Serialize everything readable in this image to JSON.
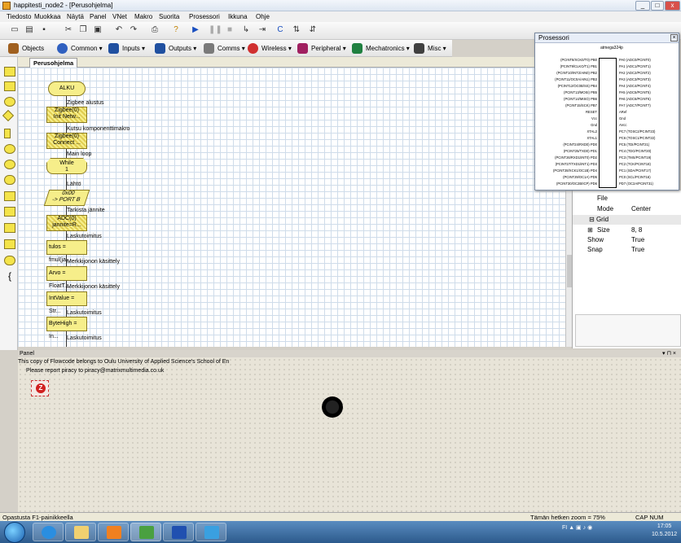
{
  "window": {
    "title": "happitesti_node2 - [Perusohjelma]",
    "buttons": [
      "_",
      "□",
      "x"
    ]
  },
  "menu": [
    "Tiedosto",
    "Muokkaa",
    "Näytä",
    "Panel",
    "VNet",
    "Makro",
    "Suorita",
    "Prosessori",
    "Ikkuna",
    "Ohje"
  ],
  "toolbar2": [
    "Objects",
    "Common",
    "Inputs",
    "Outputs",
    "Comms",
    "Wireless",
    "Peripheral",
    "Mechatronics",
    "Misc"
  ],
  "tab": "Perusohjelma",
  "flowchart": {
    "blocks": [
      "ALKU",
      "Zigbee(0)\nInit  Netw...",
      "Zigbee(0)\nConnect ...",
      "While\n1",
      "0x00\n-> PORT B",
      "ADC(0)\njannite=R...",
      "tulos = fmul(ja...",
      "Arvo = FloatT...",
      "IntValue = Str...",
      "ByteHigh = In..."
    ],
    "comments": [
      "Zigbee alustus",
      "Kutsu komponenttimakro",
      "Main loop",
      "Lähtö",
      "Tarkista jännite",
      "Laskutoimitus",
      "Merkkijonon käsittely",
      "Merkkijonon käsittely",
      "Laskutoimitus",
      "Laskutoimitus"
    ]
  },
  "processor": {
    "title": "Prosessori",
    "chip": "atmega324p",
    "left_pins": [
      "(PCINT8/XCK0/T0) PB0",
      "(PCINT9/CLKO/T1) PB1",
      "(PCINT10/INT2/AIN0) PB2",
      "(PCINT11/OC0A/AIN1) PB3",
      "(PCINT12/OC0B/SS) PB4",
      "(PCINT13/MOSI) PB5",
      "(PCINT14/MISO) PB6",
      "(PCINT15/SCK) PB7",
      "RESET",
      "Vcc",
      "Gnd",
      "XTAL2",
      "XTAL1",
      "(PCINT24/RXD0) PD0",
      "(PCINT25/TXD0) PD1",
      "(PCINT26/RXD1/INT0) PD2",
      "(PCINT27/TXD1/INT1) PD3",
      "(PCINT28/XCK1/OC1B) PD4",
      "(PCINT29/OC1A) PD5",
      "(PCINT30/OC2B/ICP) PD6"
    ],
    "right_pins": [
      "PA0 (ADC0/PCINT0)",
      "PA1 (ADC1/PCINT1)",
      "PA2 (ADC2/PCINT2)",
      "PA3 (ADC3/PCINT3)",
      "PA4 (ADC4/PCINT4)",
      "PA5 (ADC5/PCINT5)",
      "PA6 (ADC6/PCINT6)",
      "PA7 (ADC7/PCINT7)",
      "ARef",
      "Gnd",
      "AVcc",
      "PC7 (TOSC2/PCINT23)",
      "PC6 (TOSC1/PCINT22)",
      "PC5 (TDI/PCINT21)",
      "PC4 (TDO/PCINT20)",
      "PC3 (TMS/PCINT19)",
      "PC2 (TCK/PCINT18)",
      "PC1 (SDA/PCINT17)",
      "PC0 (SCL/PCINT16)",
      "PD7 (OC2A/PCINT31)"
    ]
  },
  "properties": {
    "file_label": "File",
    "mode_key": "Mode",
    "mode_val": "Center",
    "grid_label": "Grid",
    "size_key": "Size",
    "size_val": "8, 8",
    "show_key": "Show",
    "show_val": "True",
    "snap_key": "Snap",
    "snap_val": "True"
  },
  "panel": {
    "title": "Panel",
    "copy1": "This copy of Flowcode belongs to Oulu University of Applied Science's School of En",
    "copy2": "Please report piracy to piracy@matrixmultimedia.co.uk",
    "z": "Z"
  },
  "status": {
    "left": "Opastusta F1-painikkeella",
    "zoom": "Tämän hetken zoom = 75%",
    "keys": "CAP  NUM  SCRL"
  },
  "tray": {
    "lang": "FI",
    "time": "17:05",
    "date": "10.5.2012"
  }
}
